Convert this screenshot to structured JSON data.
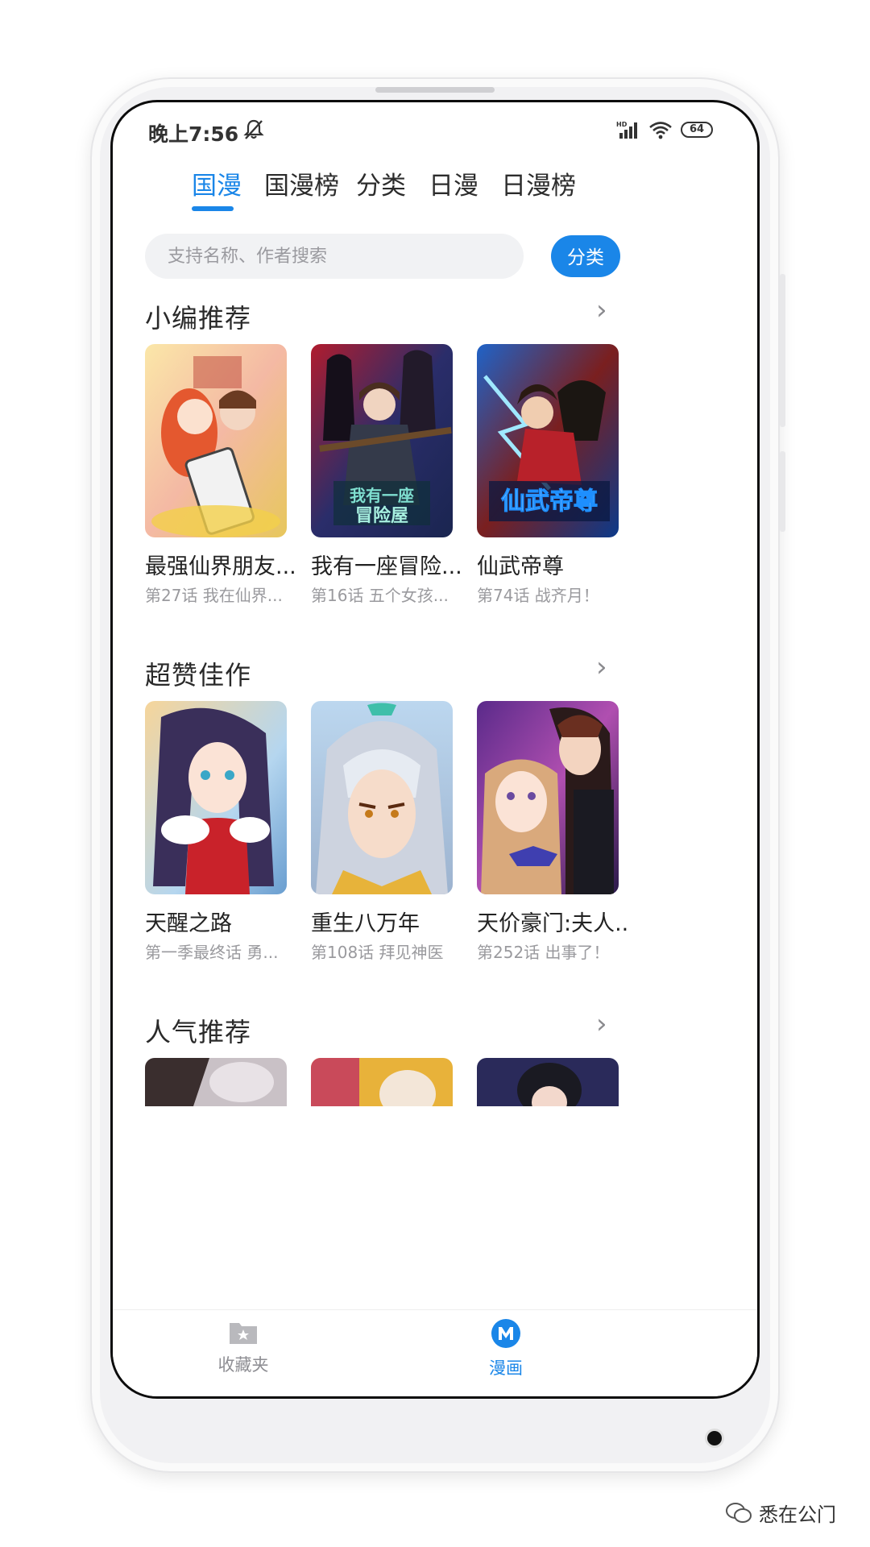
{
  "status_bar": {
    "time": "晚上7:56",
    "battery": "64"
  },
  "tabs": [
    {
      "label": "国漫",
      "active": true
    },
    {
      "label": "国漫榜",
      "active": false
    },
    {
      "label": "分类",
      "active": false
    },
    {
      "label": "日漫",
      "active": false
    },
    {
      "label": "日漫榜",
      "active": false
    }
  ],
  "search": {
    "placeholder": "支持名称、作者搜索",
    "button_label": "分类"
  },
  "sections": [
    {
      "title": "小编推荐",
      "items": [
        {
          "title": "最强仙界朋友...",
          "subtitle": "第27话 我在仙界..."
        },
        {
          "title": "我有一座冒险...",
          "subtitle": "第16话 五个女孩...",
          "cover_text": "我有一座冒险屋"
        },
        {
          "title": "仙武帝尊",
          "subtitle": "第74话 战齐月！",
          "cover_text": "仙武帝尊"
        }
      ]
    },
    {
      "title": "超赞佳作",
      "items": [
        {
          "title": "天醒之路",
          "subtitle": "第一季最终话 勇..."
        },
        {
          "title": "重生八万年",
          "subtitle": "第108话 拜见神医"
        },
        {
          "title": "天价豪门:夫人...",
          "subtitle": "第252话 出事了！"
        }
      ]
    },
    {
      "title": "人气推荐"
    }
  ],
  "bottom_nav": [
    {
      "label": "收藏夹",
      "icon": "folder-star-icon",
      "active": false
    },
    {
      "label": "漫画",
      "icon": "m-logo-icon",
      "active": true
    }
  ],
  "watermark": "悉在公门",
  "colors": {
    "accent": "#1a86e8",
    "text": "#222222",
    "muted": "#9a9a9e"
  }
}
